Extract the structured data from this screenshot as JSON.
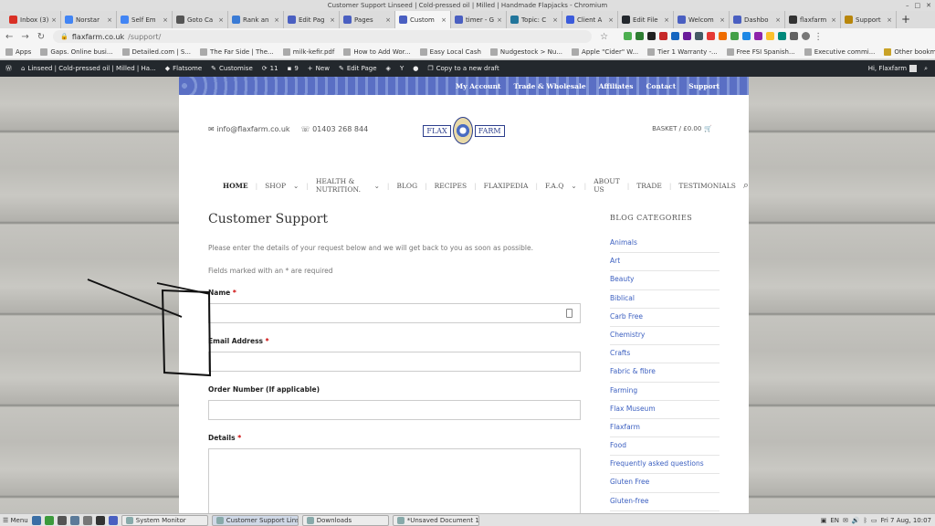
{
  "window": {
    "title": "Customer Support Linseed | Cold-pressed oil | Milled | Handmade Flapjacks - Chromium"
  },
  "tabs": [
    {
      "label": "Inbox (3)",
      "color": "#d93025",
      "active": false
    },
    {
      "label": "Norstar",
      "color": "#4285f4",
      "active": false
    },
    {
      "label": "Self Em",
      "color": "#4285f4",
      "active": false
    },
    {
      "label": "Goto Ca",
      "color": "#555555",
      "active": false
    },
    {
      "label": "Rank an",
      "color": "#3a7bd5",
      "active": false
    },
    {
      "label": "Edit Pag",
      "color": "#4a5fc1",
      "active": false
    },
    {
      "label": "Pages",
      "color": "#4a5fc1",
      "active": false
    },
    {
      "label": "Custom",
      "color": "#4a5fc1",
      "active": true
    },
    {
      "label": "timer - G",
      "color": "#4a5fc1",
      "active": false
    },
    {
      "label": "Topic: C",
      "color": "#21759b",
      "active": false
    },
    {
      "label": "Client A",
      "color": "#3b5bdb",
      "active": false
    },
    {
      "label": "Edit File",
      "color": "#23282d",
      "active": false
    },
    {
      "label": "Welcom",
      "color": "#4a5fc1",
      "active": false
    },
    {
      "label": "Dashbo",
      "color": "#4a5fc1",
      "active": false
    },
    {
      "label": "flaxfarm",
      "color": "#333333",
      "active": false
    },
    {
      "label": "Support",
      "color": "#b8860b",
      "active": false
    }
  ],
  "address_bar": {
    "host": "flaxfarm.co.uk",
    "path": "/support/"
  },
  "bookmarks": [
    "Apps",
    "Gaps. Online busi...",
    "Detailed.com | S...",
    "The Far Side | The...",
    "milk-kefir.pdf",
    "How to Add Wor...",
    "Easy Local Cash",
    "Nudgestock > Nu...",
    "Apple \"Cider\" W...",
    "Tier 1 Warranty -...",
    "Free FSI Spanish...",
    "Executive commi..."
  ],
  "other_bookmarks": "Other bookmarks",
  "wp_admin_bar": {
    "site": "Linseed | Cold-pressed oil | Milled | Ha...",
    "flatsome": "Flatsome",
    "customise": "Customise",
    "updates": "11",
    "comments": "9",
    "new": "New",
    "edit_page": "Edit Page",
    "copy_draft": "Copy to a new draft",
    "greeting": "Hi, Flaxfarm"
  },
  "topbar_links": [
    "My Account",
    "Trade & Wholesale",
    "Affiliates",
    "Contact",
    "Support"
  ],
  "header": {
    "email": "info@flaxfarm.co.uk",
    "phone": "01403 268 844",
    "logo_left": "FLAX",
    "logo_right": "FARM",
    "basket": "BASKET / £0.00"
  },
  "main_menu": [
    "HOME",
    "SHOP",
    "HEALTH & NUTRITION.",
    "BLOG",
    "RECIPES",
    "FLAXIPEDIA",
    "F.A.Q",
    "ABOUT US",
    "TRADE",
    "TESTIMONIALS"
  ],
  "page": {
    "title": "Customer Support",
    "description": "Please enter the details of your request below and we will get back to you as soon as possible.",
    "required_note": "Fields marked with an * are required"
  },
  "form": {
    "name_label": "Name",
    "email_label": "Email Address",
    "order_label": "Order Number (If applicable)",
    "details_label": "Details",
    "required_star": "*"
  },
  "sidebar": {
    "heading": "BLOG CATEGORIES",
    "categories": [
      "Animals",
      "Art",
      "Beauty",
      "Biblical",
      "Carb Free",
      "Chemistry",
      "Crafts",
      "Fabric & fibre",
      "Farming",
      "Flax Museum",
      "Flaxfarm",
      "Food",
      "Frequently asked questions",
      "Gluten Free",
      "Gluten-free"
    ]
  },
  "taskbar": {
    "menu": "Menu",
    "tasks": [
      "System Monitor",
      "Customer Support Lins...",
      "Downloads",
      "*Unsaved Document 1"
    ],
    "language": "EN",
    "clock": "Fri 7 Aug, 10:07"
  }
}
